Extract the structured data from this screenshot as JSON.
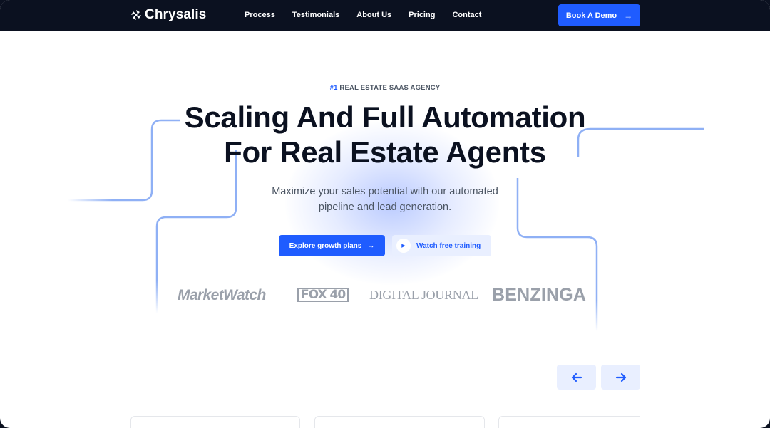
{
  "nav": {
    "brand": "Chrysalis",
    "links": [
      "Process",
      "Testimonials",
      "About Us",
      "Pricing",
      "Contact"
    ],
    "cta_label": "Book A Demo"
  },
  "hero": {
    "eyebrow_hash": "#1",
    "eyebrow_text": "REAL ESTATE SAAS AGENCY",
    "headline_line1": "Scaling And Full Automation",
    "headline_line2": "For Real Estate Agents",
    "sub_line1": "Maximize your sales potential with our automated",
    "sub_line2": "pipeline and lead generation.",
    "primary_button": "Explore growth plans",
    "secondary_button": "Watch free training"
  },
  "press_logos": [
    "MarketWatch",
    "FOX 40",
    "DIGITAL JOURNAL",
    "BENZINGA"
  ],
  "carousel": {
    "prev_icon": "arrow-left-icon",
    "next_icon": "arrow-right-icon"
  },
  "colors": {
    "nav_bg": "#0b1120",
    "accent": "#1f5cff",
    "accent_light": "#e9efff",
    "heading": "#0b1120",
    "body_text": "#4b5563",
    "logo_gray": "#9aa0aa"
  }
}
